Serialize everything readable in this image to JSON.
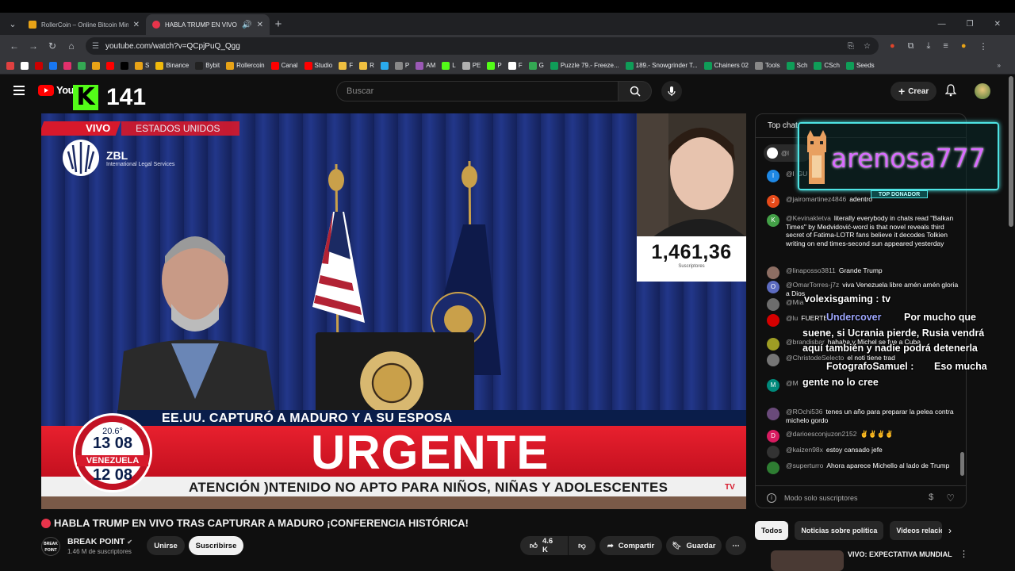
{
  "browser": {
    "tabs": [
      {
        "title": "RollerCoin – Online Bitcoin Mining",
        "active": false
      },
      {
        "title": "HABLA TRUMP EN VIVO",
        "active": true
      }
    ],
    "url": "youtube.com/watch?v=QCpjPuQ_Qgg",
    "bookmarks": [
      {
        "label": "",
        "color": "#e04040"
      },
      {
        "label": "",
        "color": "#ffffff"
      },
      {
        "label": "",
        "color": "#cc0000"
      },
      {
        "label": "",
        "color": "#1877f2"
      },
      {
        "label": "",
        "color": "#e1306c"
      },
      {
        "label": "",
        "color": "#34a853"
      },
      {
        "label": "",
        "color": "#e8a317"
      },
      {
        "label": "",
        "color": "#ff0000"
      },
      {
        "label": "",
        "color": "#000000"
      },
      {
        "label": "S",
        "color": "#e8a317"
      },
      {
        "label": "Binance",
        "color": "#f0b90b"
      },
      {
        "label": "Bybit",
        "color": "#222222"
      },
      {
        "label": "Rollercoin",
        "color": "#e8a317"
      },
      {
        "label": "Canal",
        "color": "#ff0000"
      },
      {
        "label": "Studio",
        "color": "#ff0000"
      },
      {
        "label": "F",
        "color": "#f0c040"
      },
      {
        "label": "R",
        "color": "#f0c040"
      },
      {
        "label": "",
        "color": "#2aabee"
      },
      {
        "label": "P",
        "color": "#888888"
      },
      {
        "label": "AM",
        "color": "#9b59b6"
      },
      {
        "label": "L",
        "color": "#53fc18"
      },
      {
        "label": "PE",
        "color": "#b0b0b0"
      },
      {
        "label": "P",
        "color": "#53fc18"
      },
      {
        "label": "F",
        "color": "#ffffff"
      },
      {
        "label": "G",
        "color": "#34a853"
      },
      {
        "label": "Puzzle 79.- Freeze...",
        "color": "#0f9d58"
      },
      {
        "label": "189.- Snowgrinder T...",
        "color": "#0f9d58"
      },
      {
        "label": "Chainers 02",
        "color": "#0f9d58"
      },
      {
        "label": "Tools",
        "color": "#888888"
      },
      {
        "label": "Sch",
        "color": "#0f9d58"
      },
      {
        "label": "CSch",
        "color": "#0f9d58"
      },
      {
        "label": "Seeds",
        "color": "#0f9d58"
      }
    ]
  },
  "youtube": {
    "logo_text": "YouTube",
    "kick_count": "141",
    "search_placeholder": "Buscar",
    "create_label": "Crear"
  },
  "video": {
    "live_label": "VIVO",
    "country_label": "ESTADOS UNIDOS",
    "zbl_title": "ZBL",
    "zbl_sub": "International Legal Services",
    "subscriber_count": "1,461,36",
    "subscriber_label": "Suscriptores",
    "caption": "EE.UU. CAPTURÓ A MADURO Y A SU ESPOSA",
    "headline": "URGENTE",
    "warning": "ATENCIÓN  )NTENIDO NO APTO PARA NIÑOS, NIÑAS Y ADOLESCENTES",
    "clock_temp": "20.6°",
    "clock_us": "13 08",
    "clock_ven_label": "VENEZUELA",
    "clock_ven": "12 08"
  },
  "chat": {
    "header": "Top chat",
    "pinned": "@l",
    "messages": [
      {
        "author": "@l",
        "text": "GU",
        "avatar": "l",
        "color": "#1e88e5"
      },
      {
        "author": "@jairomartinez4846",
        "text": "adentro",
        "avatar": "J",
        "color": "#e64a19"
      },
      {
        "author": "@Kevinakletva",
        "text": "literally everybody in chats read \"Balkan Times\" by Medvidović-word is that novel reveals third secret of Fatima-LOTR fans believe it decodes Tolkien writing on end times-second sun appeared yesterday",
        "avatar": "K",
        "color": "#43a047"
      },
      {
        "author": "@linaposso3811",
        "text": "Grande Trump",
        "avatar": "",
        "color": "#8d6e63"
      },
      {
        "author": "@OmarTorres-j7z",
        "text": "viva Venezuela libre amén amén gloria a Dios",
        "avatar": "O",
        "color": "#5c6bc0"
      },
      {
        "author": "@Mia",
        "text": "",
        "avatar": "",
        "color": "#6d6d6d"
      },
      {
        "author": "@lu",
        "text": "FUERTE",
        "avatar": "",
        "color": "#d50000"
      },
      {
        "author": "@brandisbar",
        "text": "hahaha y Michel se fue a Cuba",
        "avatar": "",
        "color": "#9e9d24"
      },
      {
        "author": "@ChristodeSelecto",
        "text": "el noti tiene trad",
        "avatar": "",
        "color": "#757575"
      },
      {
        "author": "@M",
        "text": "",
        "avatar": "M",
        "color": "#00897b"
      },
      {
        "author": "@ROchi536",
        "text": "tenes un año para preparar la pelea contra michelo gordo",
        "avatar": "",
        "color": "#6a4a7a"
      },
      {
        "author": "@darioesconjuzon2152",
        "text": "✌✌✌✌",
        "avatar": "D",
        "color": "#d81b60"
      },
      {
        "author": "@kaizen98x",
        "text": "estoy cansado jefe",
        "avatar": "",
        "color": "#333333"
      },
      {
        "author": "@superturro",
        "text": "Ahora aparece Michello al lado de Trump",
        "avatar": "",
        "color": "#2e7d32"
      }
    ],
    "footer": "Modo solo suscriptores"
  },
  "overlay": {
    "donor_name": "arenosa777",
    "donor_tag": "TOP DONADOR",
    "alert1": "volexisgaming : tv",
    "alert2_author": "Undercover",
    "alert2": "Por mucho que",
    "alert3": "suene, si Ucrania pierde, Rusia vendrá",
    "alert4": "aquí también y nadie podrá detenerla",
    "alert5_author": "FotografoSamuel :",
    "alert5": "Eso mucha",
    "alert6": "gente no lo cree"
  },
  "page": {
    "title": "HABLA TRUMP EN VIVO TRAS CAPTURAR A MADURO ¡CONFERENCIA HISTÓRICA!",
    "channel": "BREAK POINT",
    "channel_subs": "1.46 M de suscriptores",
    "join": "Unirse",
    "subscribe": "Suscribirse",
    "likes": "4.6 K",
    "share": "Compartir",
    "save": "Guardar",
    "chips": [
      "Todos",
      "Noticias sobre política",
      "Videos relacio"
    ],
    "rec_title": "VIVO: EXPECTATIVA MUNDIAL"
  },
  "colors": {
    "accent": "#ff0000",
    "kick": "#53fc18",
    "urgent": "#d7192c"
  }
}
